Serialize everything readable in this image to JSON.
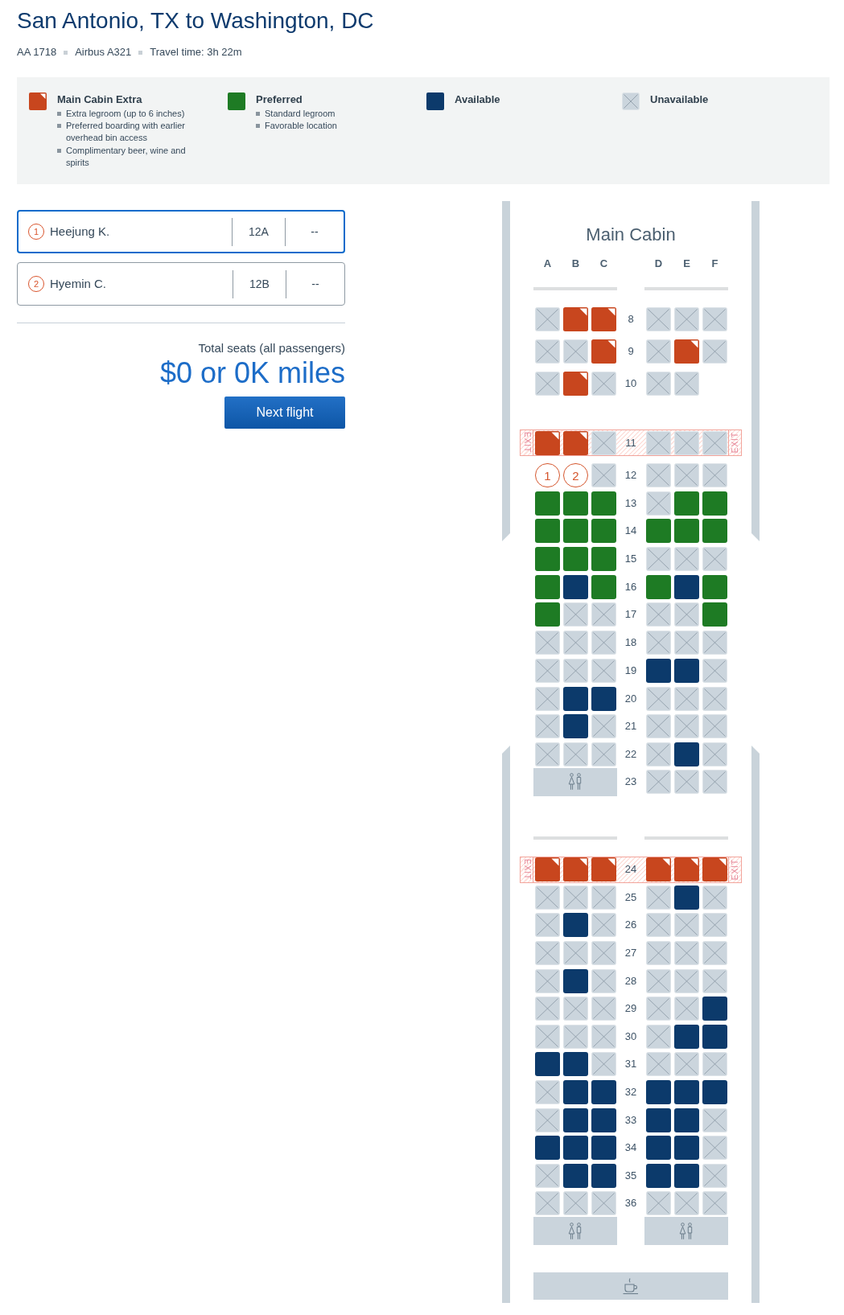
{
  "header": {
    "title": "San Antonio, TX to Washington, DC",
    "details": [
      "AA 1718",
      "Airbus A321",
      "Travel time: 3h 22m"
    ]
  },
  "legend": [
    {
      "kind": "extra",
      "title": "Main Cabin Extra",
      "bullets": [
        "Extra legroom (up to 6 inches)",
        "Preferred boarding with earlier overhead bin access",
        "Complimentary beer, wine and spirits"
      ]
    },
    {
      "kind": "preferred",
      "title": "Preferred",
      "bullets": [
        "Standard legroom",
        "Favorable location"
      ]
    },
    {
      "kind": "available",
      "title": "Available"
    },
    {
      "kind": "unavailable",
      "title": "Unavailable"
    }
  ],
  "passengers": [
    {
      "number": "1",
      "name": "Heejung K.",
      "seat": "12A",
      "column_3": "--",
      "selected": true
    },
    {
      "number": "2",
      "name": "Hyemin C.",
      "seat": "12B",
      "column_3": "--",
      "selected": false
    }
  ],
  "total": {
    "label": "Total seats (all passengers)",
    "amount": "$0 or 0K miles"
  },
  "next_button": "Next flight",
  "seat_map": {
    "title": "Main Cabin",
    "columns": {
      "left": [
        "A",
        "B",
        "C"
      ],
      "right": [
        "D",
        "E",
        "F"
      ]
    },
    "sections": [
      {
        "rows": [
          {
            "number": "8",
            "exit": false,
            "left": [
              {
                "kind": "unavailable"
              },
              {
                "kind": "extra"
              },
              {
                "kind": "extra"
              }
            ],
            "right": [
              {
                "kind": "unavailable"
              },
              {
                "kind": "unavailable"
              },
              {
                "kind": "unavailable"
              }
            ]
          },
          {
            "number": "9",
            "exit": false,
            "left": [
              {
                "kind": "unavailable"
              },
              {
                "kind": "unavailable"
              },
              {
                "kind": "extra"
              }
            ],
            "right": [
              {
                "kind": "unavailable"
              },
              {
                "kind": "extra"
              },
              {
                "kind": "unavailable"
              }
            ]
          },
          {
            "number": "10",
            "exit": false,
            "left": [
              {
                "kind": "unavailable"
              },
              {
                "kind": "extra"
              },
              {
                "kind": "unavailable"
              }
            ],
            "right": [
              {
                "kind": "unavailable"
              },
              {
                "kind": "unavailable"
              }
            ]
          },
          {
            "number": "11",
            "exit": true,
            "exit_labels": [
              "EXIT",
              "EXIT"
            ],
            "left": [
              {
                "kind": "extra"
              },
              {
                "kind": "extra"
              },
              {
                "kind": "unavailable"
              }
            ],
            "right": [
              {
                "kind": "unavailable"
              },
              {
                "kind": "unavailable"
              },
              {
                "kind": "unavailable"
              }
            ]
          },
          {
            "number": "12",
            "exit": false,
            "left": [
              {
                "kind": "assigned",
                "label": "1"
              },
              {
                "kind": "assigned",
                "label": "2"
              },
              {
                "kind": "unavailable"
              }
            ],
            "right": [
              {
                "kind": "unavailable"
              },
              {
                "kind": "unavailable"
              },
              {
                "kind": "unavailable"
              }
            ]
          },
          {
            "number": "13",
            "exit": false,
            "left": [
              {
                "kind": "preferred"
              },
              {
                "kind": "preferred"
              },
              {
                "kind": "preferred"
              }
            ],
            "right": [
              {
                "kind": "unavailable"
              },
              {
                "kind": "preferred"
              },
              {
                "kind": "preferred"
              }
            ]
          },
          {
            "number": "14",
            "exit": false,
            "left": [
              {
                "kind": "preferred"
              },
              {
                "kind": "preferred"
              },
              {
                "kind": "preferred"
              }
            ],
            "right": [
              {
                "kind": "preferred"
              },
              {
                "kind": "preferred"
              },
              {
                "kind": "preferred"
              }
            ]
          },
          {
            "number": "15",
            "exit": false,
            "left": [
              {
                "kind": "preferred"
              },
              {
                "kind": "preferred"
              },
              {
                "kind": "preferred"
              }
            ],
            "right": [
              {
                "kind": "unavailable"
              },
              {
                "kind": "unavailable"
              },
              {
                "kind": "unavailable"
              }
            ]
          },
          {
            "number": "16",
            "exit": false,
            "left": [
              {
                "kind": "preferred"
              },
              {
                "kind": "available"
              },
              {
                "kind": "preferred"
              }
            ],
            "right": [
              {
                "kind": "preferred"
              },
              {
                "kind": "available"
              },
              {
                "kind": "preferred"
              }
            ]
          },
          {
            "number": "17",
            "exit": false,
            "left": [
              {
                "kind": "preferred"
              },
              {
                "kind": "unavailable"
              },
              {
                "kind": "unavailable"
              }
            ],
            "right": [
              {
                "kind": "unavailable"
              },
              {
                "kind": "unavailable"
              },
              {
                "kind": "preferred"
              }
            ]
          },
          {
            "number": "18",
            "exit": false,
            "left": [
              {
                "kind": "unavailable"
              },
              {
                "kind": "unavailable"
              },
              {
                "kind": "unavailable"
              }
            ],
            "right": [
              {
                "kind": "unavailable"
              },
              {
                "kind": "unavailable"
              },
              {
                "kind": "unavailable"
              }
            ]
          },
          {
            "number": "19",
            "exit": false,
            "left": [
              {
                "kind": "unavailable"
              },
              {
                "kind": "unavailable"
              },
              {
                "kind": "unavailable"
              }
            ],
            "right": [
              {
                "kind": "available"
              },
              {
                "kind": "available"
              },
              {
                "kind": "unavailable"
              }
            ]
          },
          {
            "number": "20",
            "exit": false,
            "left": [
              {
                "kind": "unavailable"
              },
              {
                "kind": "available"
              },
              {
                "kind": "available"
              }
            ],
            "right": [
              {
                "kind": "unavailable"
              },
              {
                "kind": "unavailable"
              },
              {
                "kind": "unavailable"
              }
            ]
          },
          {
            "number": "21",
            "exit": false,
            "left": [
              {
                "kind": "unavailable"
              },
              {
                "kind": "available"
              },
              {
                "kind": "unavailable"
              }
            ],
            "right": [
              {
                "kind": "unavailable"
              },
              {
                "kind": "unavailable"
              },
              {
                "kind": "unavailable"
              }
            ]
          },
          {
            "number": "22",
            "exit": false,
            "left": [
              {
                "kind": "unavailable"
              },
              {
                "kind": "unavailable"
              },
              {
                "kind": "unavailable"
              }
            ],
            "right": [
              {
                "kind": "unavailable"
              },
              {
                "kind": "available"
              },
              {
                "kind": "unavailable"
              }
            ]
          },
          {
            "number": "23",
            "exit": false,
            "left": [
              {
                "kind": "lavatory"
              }
            ],
            "right": [
              {
                "kind": "unavailable"
              },
              {
                "kind": "unavailable"
              },
              {
                "kind": "unavailable"
              }
            ]
          }
        ]
      },
      {
        "rows": [
          {
            "number": "24",
            "exit": true,
            "exit_labels": [
              "EXIT",
              "EXIT"
            ],
            "left": [
              {
                "kind": "extra"
              },
              {
                "kind": "extra"
              },
              {
                "kind": "extra"
              }
            ],
            "right": [
              {
                "kind": "extra"
              },
              {
                "kind": "extra"
              },
              {
                "kind": "extra"
              }
            ]
          },
          {
            "number": "25",
            "exit": false,
            "left": [
              {
                "kind": "unavailable"
              },
              {
                "kind": "unavailable"
              },
              {
                "kind": "unavailable"
              }
            ],
            "right": [
              {
                "kind": "unavailable"
              },
              {
                "kind": "available"
              },
              {
                "kind": "unavailable"
              }
            ]
          },
          {
            "number": "26",
            "exit": false,
            "left": [
              {
                "kind": "unavailable"
              },
              {
                "kind": "available"
              },
              {
                "kind": "unavailable"
              }
            ],
            "right": [
              {
                "kind": "unavailable"
              },
              {
                "kind": "unavailable"
              },
              {
                "kind": "unavailable"
              }
            ]
          },
          {
            "number": "27",
            "exit": false,
            "left": [
              {
                "kind": "unavailable"
              },
              {
                "kind": "unavailable"
              },
              {
                "kind": "unavailable"
              }
            ],
            "right": [
              {
                "kind": "unavailable"
              },
              {
                "kind": "unavailable"
              },
              {
                "kind": "unavailable"
              }
            ]
          },
          {
            "number": "28",
            "exit": false,
            "left": [
              {
                "kind": "unavailable"
              },
              {
                "kind": "available"
              },
              {
                "kind": "unavailable"
              }
            ],
            "right": [
              {
                "kind": "unavailable"
              },
              {
                "kind": "unavailable"
              },
              {
                "kind": "unavailable"
              }
            ]
          },
          {
            "number": "29",
            "exit": false,
            "left": [
              {
                "kind": "unavailable"
              },
              {
                "kind": "unavailable"
              },
              {
                "kind": "unavailable"
              }
            ],
            "right": [
              {
                "kind": "unavailable"
              },
              {
                "kind": "unavailable"
              },
              {
                "kind": "available"
              }
            ]
          },
          {
            "number": "30",
            "exit": false,
            "left": [
              {
                "kind": "unavailable"
              },
              {
                "kind": "unavailable"
              },
              {
                "kind": "unavailable"
              }
            ],
            "right": [
              {
                "kind": "unavailable"
              },
              {
                "kind": "available"
              },
              {
                "kind": "available"
              }
            ]
          },
          {
            "number": "31",
            "exit": false,
            "left": [
              {
                "kind": "available"
              },
              {
                "kind": "available"
              },
              {
                "kind": "unavailable"
              }
            ],
            "right": [
              {
                "kind": "unavailable"
              },
              {
                "kind": "unavailable"
              },
              {
                "kind": "unavailable"
              }
            ]
          },
          {
            "number": "32",
            "exit": false,
            "left": [
              {
                "kind": "unavailable"
              },
              {
                "kind": "available"
              },
              {
                "kind": "available"
              }
            ],
            "right": [
              {
                "kind": "available"
              },
              {
                "kind": "available"
              },
              {
                "kind": "available"
              }
            ]
          },
          {
            "number": "33",
            "exit": false,
            "left": [
              {
                "kind": "unavailable"
              },
              {
                "kind": "available"
              },
              {
                "kind": "available"
              }
            ],
            "right": [
              {
                "kind": "available"
              },
              {
                "kind": "available"
              },
              {
                "kind": "unavailable"
              }
            ]
          },
          {
            "number": "34",
            "exit": false,
            "left": [
              {
                "kind": "available"
              },
              {
                "kind": "available"
              },
              {
                "kind": "available"
              }
            ],
            "right": [
              {
                "kind": "available"
              },
              {
                "kind": "available"
              },
              {
                "kind": "unavailable"
              }
            ]
          },
          {
            "number": "35",
            "exit": false,
            "left": [
              {
                "kind": "unavailable"
              },
              {
                "kind": "available"
              },
              {
                "kind": "available"
              }
            ],
            "right": [
              {
                "kind": "available"
              },
              {
                "kind": "available"
              },
              {
                "kind": "unavailable"
              }
            ]
          },
          {
            "number": "36",
            "exit": false,
            "left": [
              {
                "kind": "unavailable"
              },
              {
                "kind": "unavailable"
              },
              {
                "kind": "unavailable"
              }
            ],
            "right": [
              {
                "kind": "unavailable"
              },
              {
                "kind": "unavailable"
              },
              {
                "kind": "unavailable"
              }
            ]
          },
          {
            "left": [
              {
                "kind": "lavatory"
              }
            ],
            "right": [
              {
                "kind": "lavatory"
              }
            ]
          },
          {
            "span": [
              {
                "kind": "galley"
              }
            ]
          }
        ]
      }
    ]
  }
}
